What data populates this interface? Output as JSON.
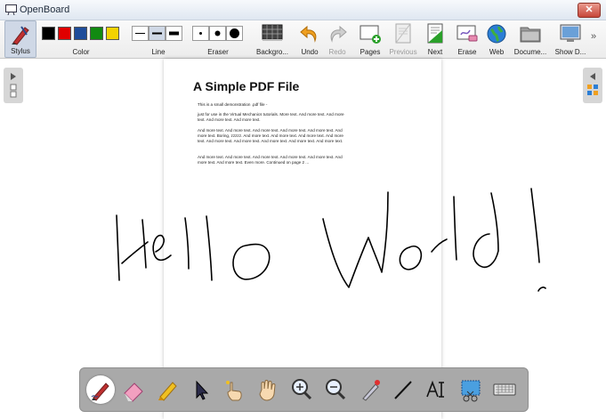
{
  "window": {
    "title": "OpenBoard",
    "close_glyph": "✕"
  },
  "toolbar": {
    "stylus": {
      "label": "Stylus"
    },
    "color": {
      "label": "Color",
      "swatches": [
        "#000000",
        "#e00000",
        "#1f4d9a",
        "#118a11",
        "#f2d200"
      ]
    },
    "line": {
      "label": "Line"
    },
    "eraser": {
      "label": "Eraser"
    },
    "background": {
      "label": "Backgro..."
    },
    "undo": {
      "label": "Undo"
    },
    "redo": {
      "label": "Redo"
    },
    "pages": {
      "label": "Pages"
    },
    "previous": {
      "label": "Previous"
    },
    "next": {
      "label": "Next"
    },
    "erase": {
      "label": "Erase"
    },
    "web": {
      "label": "Web"
    },
    "documents": {
      "label": "Docume..."
    },
    "show_desktop": {
      "label": "Show D..."
    },
    "overflow_glyph": "»"
  },
  "document": {
    "title": "A Simple PDF File",
    "paragraphs": [
      "This is a small demonstration .pdf file -",
      "just for use in the Virtual Mechanics tutorials. More text. And more text. And more text. And more text. And more text.",
      "And more text. And more text. And more text. And more text. And more text. And more text. Boring, zzzzz. And more text. And more text. And more text. And more text. And more text. And more text. And more text. And more text. And more text.",
      "And more text. And more text. And more text. And more text. And more text. And more text. And more text. Even more. Continued on page 2 ..."
    ]
  },
  "handwriting": {
    "text": "Hello World!"
  },
  "dock": {
    "tools": [
      "pen",
      "eraser",
      "marker",
      "selector",
      "play",
      "hand",
      "zoom-in",
      "zoom-out",
      "laser-pointer",
      "line",
      "text",
      "capture",
      "keyboard"
    ]
  }
}
